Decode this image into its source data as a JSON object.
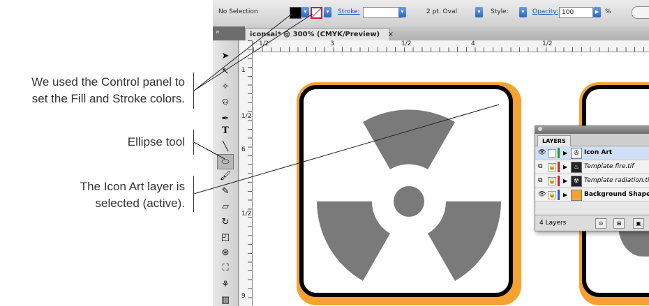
{
  "callouts": {
    "control_panel": [
      "We used the Control panel to",
      "set the Fill and Stroke colors."
    ],
    "ellipse_tool": "Ellipse tool",
    "icon_art_layer": [
      "The Icon Art layer is",
      "selected (active)."
    ]
  },
  "control_bar": {
    "selection": "No Selection",
    "stroke_label": "Stroke:",
    "brush_label": "2 pt. Oval",
    "style_label": "Style:",
    "opacity_label": "Opacity:",
    "opacity_value": "100",
    "percent": "%",
    "fill_color": "#000000",
    "stroke_color": "none"
  },
  "document_tab": {
    "title": "iconsai* @ 300% (CMYK/Preview)",
    "close": "×"
  },
  "rulers": {
    "top": [
      "1/2",
      "3",
      "1/2",
      "4",
      "1/2"
    ],
    "left": [
      "1",
      "1/2",
      "6",
      "1/2",
      "9"
    ]
  },
  "layers_panel": {
    "tab": "LAYERS",
    "rows": [
      {
        "name": "Icon Art",
        "color": "#2a9a2a",
        "selected": true,
        "style": "bold"
      },
      {
        "name": "Template fire.tif",
        "color": "#d02020",
        "selected": false,
        "style": "italic"
      },
      {
        "name": "Template radiation.tif",
        "color": "#d02020",
        "selected": false,
        "style": "italic"
      },
      {
        "name": "Background Shapes",
        "color": "#2a5ad0",
        "selected": false,
        "style": "bold"
      }
    ],
    "footer_count": "4 Layers"
  },
  "colors": {
    "icon_orange": "#f5a231",
    "radiation_gray": "#7a7a7a"
  }
}
